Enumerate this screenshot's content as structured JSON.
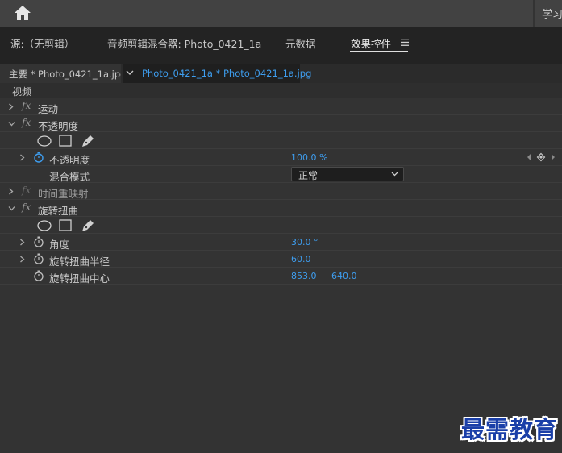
{
  "topbar": {
    "right_label": "学习"
  },
  "tabs": [
    {
      "label": "源:（无剪辑）"
    },
    {
      "label": "音频剪辑混合器: Photo_0421_1a"
    },
    {
      "label": "元数据"
    },
    {
      "label": "效果控件"
    }
  ],
  "sequence": {
    "master_label": "主要 * Photo_0421_1a.jpg",
    "clip_label": "Photo_0421_1a * Photo_0421_1a.jpg"
  },
  "section": {
    "video_label": "视频"
  },
  "effects": {
    "motion": {
      "label": "运动"
    },
    "opacity": {
      "label": "不透明度",
      "param_label": "不透明度",
      "param_value": "100.0 %",
      "blend_label": "混合模式",
      "blend_value": "正常"
    },
    "time_remap": {
      "label": "时间重映射"
    },
    "twirl": {
      "label": "旋转扭曲",
      "angle_label": "角度",
      "angle_value": "30.0 °",
      "radius_label": "旋转扭曲半径",
      "radius_value": "60.0",
      "center_label": "旋转扭曲中心",
      "center_x": "853.0",
      "center_y": "640.0"
    }
  },
  "fx_symbol": "fx",
  "watermark": "最需教育",
  "colors": {
    "accent": "#3e9ef0",
    "panel": "#333333",
    "header": "#424242"
  }
}
